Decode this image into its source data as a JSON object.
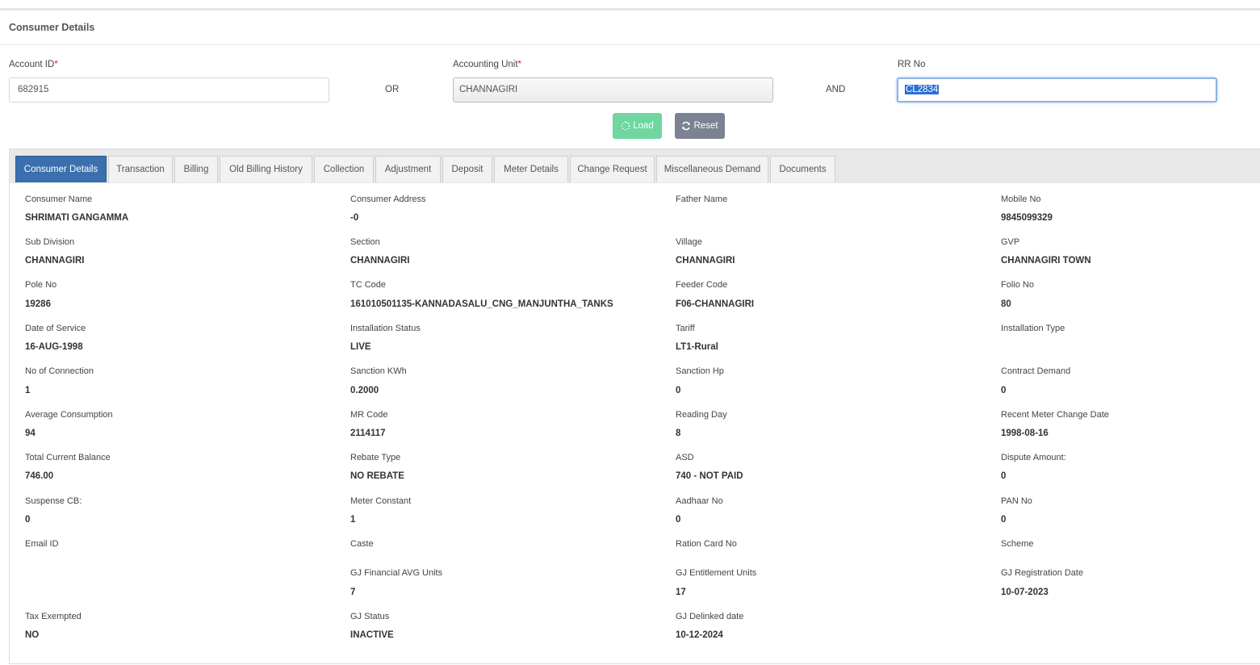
{
  "page": {
    "title": "Consumer Details"
  },
  "search": {
    "account_id_label": "Account ID",
    "account_id_value": "682915",
    "or_text": "OR",
    "accounting_unit_label": "Accounting Unit",
    "accounting_unit_value": "CHANNAGIRI",
    "and_text": "AND",
    "rr_no_label": "RR No",
    "rr_no_value": "CL2834",
    "required_marker": "*"
  },
  "buttons": {
    "load": "Load",
    "reset": "Reset"
  },
  "tabs": [
    "Consumer Details",
    "Transaction",
    "Billing",
    "Old Billing History",
    "Collection",
    "Adjustment",
    "Deposit",
    "Meter Details",
    "Change Request",
    "Miscellaneous Demand",
    "Documents"
  ],
  "details": {
    "consumer_name": {
      "label": "Consumer Name",
      "value": "SHRIMATI GANGAMMA"
    },
    "consumer_address": {
      "label": "Consumer Address",
      "value": "-0"
    },
    "father_name": {
      "label": "Father Name",
      "value": ""
    },
    "mobile_no": {
      "label": "Mobile No",
      "value": "9845099329"
    },
    "sub_division": {
      "label": "Sub Division",
      "value": "CHANNAGIRI"
    },
    "section": {
      "label": "Section",
      "value": "CHANNAGIRI"
    },
    "village": {
      "label": "Village",
      "value": "CHANNAGIRI"
    },
    "gvp": {
      "label": "GVP",
      "value": "CHANNAGIRI TOWN"
    },
    "pole_no": {
      "label": "Pole No",
      "value": "19286"
    },
    "tc_code": {
      "label": "TC Code",
      "value": "161010501135-KANNADASALU_CNG_MANJUNTHA_TANKS"
    },
    "feeder_code": {
      "label": "Feeder Code",
      "value": "F06-CHANNAGIRI"
    },
    "folio_no": {
      "label": "Folio No",
      "value": "80"
    },
    "date_of_service": {
      "label": "Date of Service",
      "value": "16-AUG-1998"
    },
    "installation_status": {
      "label": "Installation Status",
      "value": "LIVE"
    },
    "tariff": {
      "label": "Tariff",
      "value": "LT1-Rural"
    },
    "installation_type": {
      "label": "Installation Type",
      "value": ""
    },
    "no_of_connection": {
      "label": "No of Connection",
      "value": "1"
    },
    "sanction_kwh": {
      "label": "Sanction KWh",
      "value": "0.2000"
    },
    "sanction_hp": {
      "label": "Sanction Hp",
      "value": "0"
    },
    "contract_demand": {
      "label": "Contract Demand",
      "value": "0"
    },
    "average_consumption": {
      "label": "Average Consumption",
      "value": "94"
    },
    "mr_code": {
      "label": "MR Code",
      "value": "2114117"
    },
    "reading_day": {
      "label": "Reading Day",
      "value": "8"
    },
    "recent_meter_change_date": {
      "label": "Recent Meter Change Date",
      "value": "1998-08-16"
    },
    "total_current_balance": {
      "label": "Total Current Balance",
      "value": "746.00"
    },
    "rebate_type": {
      "label": "Rebate Type",
      "value": "NO REBATE"
    },
    "asd": {
      "label": "ASD",
      "value": "740 - NOT PAID"
    },
    "dispute_amount": {
      "label": "Dispute Amount:",
      "value": "0"
    },
    "suspense_cb": {
      "label": "Suspense CB:",
      "value": "0"
    },
    "meter_constant": {
      "label": "Meter Constant",
      "value": "1"
    },
    "aadhaar_no": {
      "label": "Aadhaar No",
      "value": "0"
    },
    "pan_no": {
      "label": "PAN No",
      "value": "0"
    },
    "email_id": {
      "label": "Email ID",
      "value": ""
    },
    "caste": {
      "label": "Caste",
      "value": ""
    },
    "ration_card_no": {
      "label": "Ration Card No",
      "value": ""
    },
    "scheme": {
      "label": "Scheme",
      "value": ""
    },
    "gj_financial_avg_units": {
      "label": "GJ Financial AVG Units",
      "value": "7"
    },
    "gj_entitlement_units": {
      "label": "GJ Entitlement Units",
      "value": "17"
    },
    "gj_registration_date": {
      "label": "GJ Registration Date",
      "value": "10-07-2023"
    },
    "tax_exempted": {
      "label": "Tax Exempted",
      "value": "NO"
    },
    "gj_status": {
      "label": "GJ Status",
      "value": "INACTIVE"
    },
    "gj_delinked_date": {
      "label": "GJ Delinked date",
      "value": "10-12-2024"
    }
  }
}
